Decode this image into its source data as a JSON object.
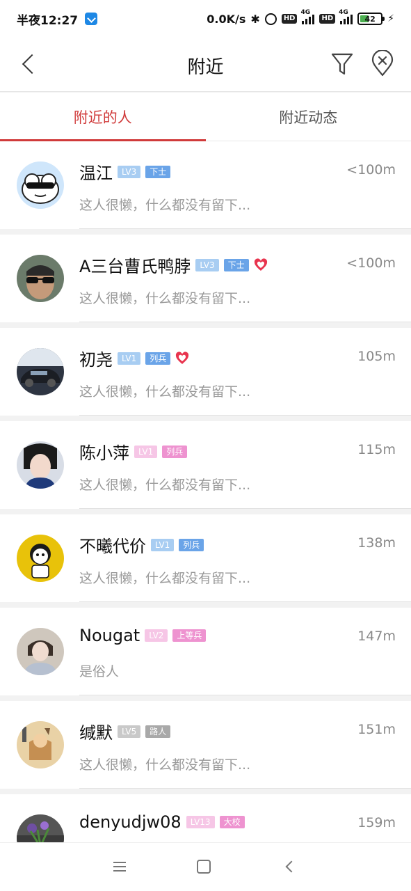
{
  "statusbar": {
    "time": "半夜12:27",
    "net_speed": "0.0K/s",
    "network_tag_1": "4G",
    "network_tag_2": "4G",
    "hd": "HD",
    "battery_level": "42",
    "battery_fraction": 0.42,
    "battery_color": "#4caf50"
  },
  "header": {
    "title": "附近",
    "icons": [
      "chevron-left-icon",
      "filter-icon",
      "location-off-icon"
    ]
  },
  "tabs": [
    {
      "label": "附近的人",
      "active": true
    },
    {
      "label": "附近动态",
      "active": false
    }
  ],
  "accent_color": "#d03a3a",
  "users": [
    {
      "name": "温江",
      "level": "LV3",
      "rank": "下士",
      "tone": "blue",
      "heart": false,
      "distance": "<100m",
      "signature": "这人很懒，什么都没有留下..."
    },
    {
      "name": "A三台曹氏鸭脖",
      "level": "LV3",
      "rank": "下士",
      "tone": "blue",
      "heart": true,
      "distance": "<100m",
      "signature": "这人很懒，什么都没有留下..."
    },
    {
      "name": "初尧",
      "level": "LV1",
      "rank": "列兵",
      "tone": "blue",
      "heart": true,
      "distance": "105m",
      "signature": "这人很懒，什么都没有留下..."
    },
    {
      "name": "陈小萍",
      "level": "LV1",
      "rank": "列兵",
      "tone": "pink",
      "heart": false,
      "distance": "115m",
      "signature": "这人很懒，什么都没有留下..."
    },
    {
      "name": "不曦代价",
      "level": "LV1",
      "rank": "列兵",
      "tone": "blue",
      "heart": false,
      "distance": "138m",
      "signature": "这人很懒，什么都没有留下..."
    },
    {
      "name": "Nougat",
      "level": "LV2",
      "rank": "上等兵",
      "tone": "pink",
      "heart": false,
      "distance": "147m",
      "signature": "是俗人"
    },
    {
      "name": "缄默",
      "level": "LV5",
      "rank": "路人",
      "tone": "gray",
      "heart": false,
      "distance": "151m",
      "signature": "这人很懒，什么都没有留下..."
    },
    {
      "name": "denyudjw08",
      "level": "LV13",
      "rank": "大校",
      "tone": "pink",
      "heart": false,
      "distance": "159m",
      "signature": ""
    }
  ],
  "navbar": {
    "icons": [
      "menu-icon",
      "home-icon",
      "back-icon"
    ]
  }
}
